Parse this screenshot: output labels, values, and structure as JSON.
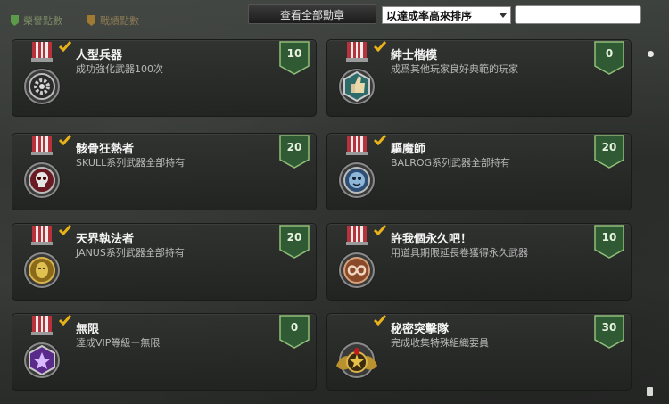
{
  "tabs": [
    {
      "label": "榮譽點數"
    },
    {
      "label": "戰績點數"
    }
  ],
  "view_all_label": "查看全部勳章",
  "sort": {
    "selected": "以達成率高來排序"
  },
  "search": {
    "value": ""
  },
  "colors": {
    "badge": "#2f5a33",
    "badge_border": "#8fbf78",
    "check": "#e8b31a",
    "title": "#f4f4f4",
    "desc": "#b8b8b8"
  },
  "medals": [
    {
      "title": "人型兵器",
      "desc": "成功強化武器100次",
      "points": "10",
      "icon": "gear-medal-icon"
    },
    {
      "title": "紳士楷模",
      "desc": "成爲其他玩家良好典範的玩家",
      "points": "0",
      "icon": "thumbs-up-medal-icon"
    },
    {
      "title": "骸骨狂熱者",
      "desc": "SKULL系列武器全部持有",
      "points": "20",
      "icon": "skull-medal-icon"
    },
    {
      "title": "驅魔師",
      "desc": "BALROG系列武器全部持有",
      "points": "20",
      "icon": "demon-medal-icon"
    },
    {
      "title": "天界執法者",
      "desc": "JANUS系列武器全部持有",
      "points": "20",
      "icon": "mask-medal-icon"
    },
    {
      "title": "許我個永久吧！",
      "desc": "用道具期限延長卷獲得永久武器",
      "points": "10",
      "icon": "infinity-medal-icon"
    },
    {
      "title": "無限",
      "desc": "達成VIP等級ー無限",
      "points": "0",
      "icon": "purple-star-medal-icon"
    },
    {
      "title": "秘密突擊隊",
      "desc": "完成收集特殊組織要員",
      "points": "30",
      "icon": "winged-star-medal-icon"
    }
  ]
}
